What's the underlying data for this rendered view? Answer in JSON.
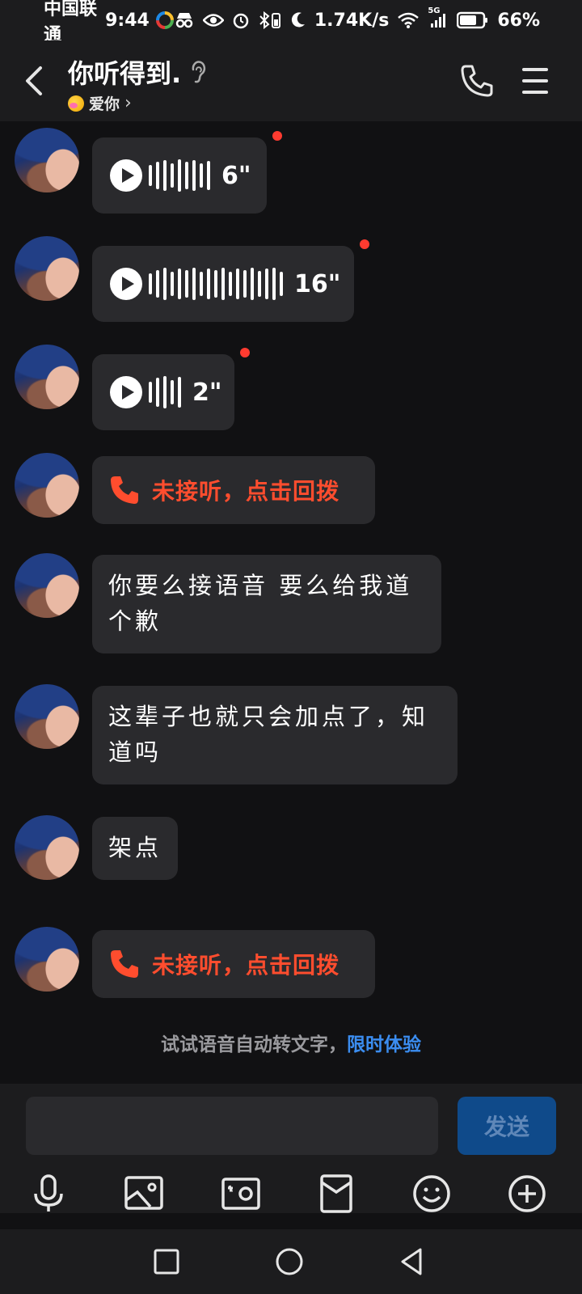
{
  "status_bar": {
    "carrier": "中国联通",
    "time": "9:44",
    "net_speed": "1.74K/s",
    "network": "5G",
    "battery": "66%"
  },
  "header": {
    "title": "你听得到.",
    "subtitle": "爱你",
    "subtitle_chevron": "›"
  },
  "messages": [
    {
      "type": "voice",
      "duration": "6\""
    },
    {
      "type": "voice",
      "duration": "16\""
    },
    {
      "type": "voice",
      "duration": "2\""
    },
    {
      "type": "missed_call",
      "text": "未接听，点击回拨"
    },
    {
      "type": "text",
      "text": "你要么接语音 要么给我道个歉"
    },
    {
      "type": "text",
      "text": "这辈子也就只会加点了，知道吗"
    },
    {
      "type": "text",
      "text": "架点"
    },
    {
      "type": "missed_call",
      "text": "未接听，点击回拨"
    }
  ],
  "hint": {
    "text": "试试语音自动转文字，",
    "link": "限时体验"
  },
  "input": {
    "placeholder": "",
    "send_label": "发送"
  },
  "toolbar_icons": [
    "microphone-icon",
    "image-icon",
    "camera-icon",
    "red-packet-icon",
    "emoji-icon",
    "plus-icon"
  ],
  "colors": {
    "background": "#111113",
    "bubble": "#2a2a2d",
    "missed_call": "#ff4d2e",
    "unread_dot": "#ff3b30",
    "link": "#3b8df0",
    "send_button": "#0f4a8a"
  }
}
